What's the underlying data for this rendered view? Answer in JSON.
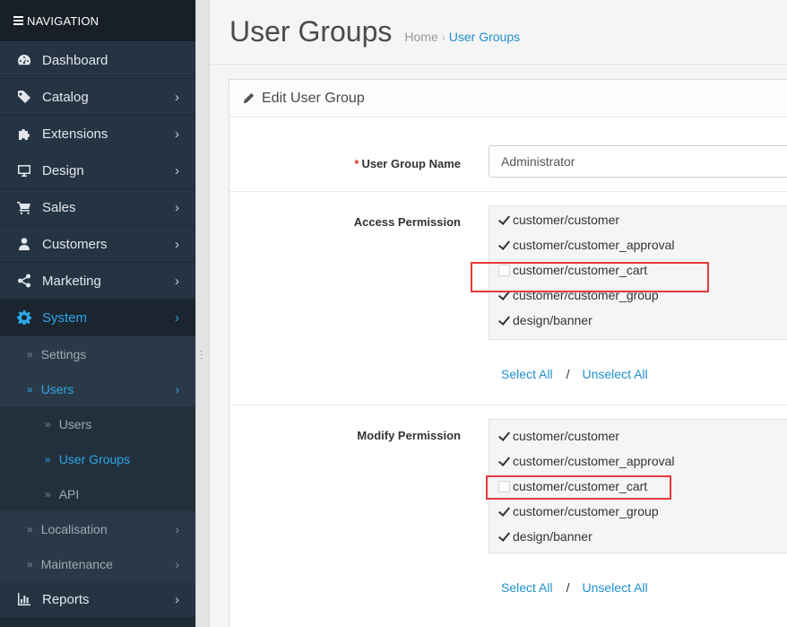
{
  "sidebar": {
    "header": "NAVIGATION",
    "items": [
      {
        "label": "Dashboard"
      },
      {
        "label": "Catalog",
        "chevron": "›"
      },
      {
        "label": "Extensions",
        "chevron": "›"
      },
      {
        "label": "Design",
        "chevron": "›"
      },
      {
        "label": "Sales",
        "chevron": "›"
      },
      {
        "label": "Customers",
        "chevron": "›"
      },
      {
        "label": "Marketing",
        "chevron": "›"
      },
      {
        "label": "System",
        "chevron": "›"
      },
      {
        "label": "Reports",
        "chevron": "›"
      }
    ],
    "system_sub": {
      "settings": "Settings",
      "users": "Users",
      "users_children": [
        "Users",
        "User Groups",
        "API"
      ],
      "localisation": "Localisation",
      "maintenance": "Maintenance"
    },
    "dq": "»",
    "chev": "›"
  },
  "header": {
    "title": "User Groups",
    "breadcrumb": [
      "Home",
      "User Groups"
    ],
    "sep": "›"
  },
  "panel": {
    "title": "Edit User Group",
    "name_label": "User Group Name",
    "required": "*",
    "name_value": "Administrator",
    "access_label": "Access Permission",
    "modify_label": "Modify Permission",
    "access_options": [
      {
        "label": "customer/customer",
        "checked": true
      },
      {
        "label": "customer/customer_approval",
        "checked": true
      },
      {
        "label": "customer/customer_cart",
        "checked": false
      },
      {
        "label": "customer/customer_group",
        "checked": true
      },
      {
        "label": "design/banner",
        "checked": true
      }
    ],
    "modify_options": [
      {
        "label": "customer/customer",
        "checked": true
      },
      {
        "label": "customer/customer_approval",
        "checked": true
      },
      {
        "label": "customer/customer_cart",
        "checked": false
      },
      {
        "label": "customer/customer_group",
        "checked": true
      },
      {
        "label": "design/banner",
        "checked": true
      }
    ],
    "select_all": "Select All",
    "slash": "/",
    "unselect_all": "Unselect All"
  },
  "colors": {
    "accent": "#1e91cf",
    "highlight": "#e8393a",
    "sidebar": "#253443"
  }
}
